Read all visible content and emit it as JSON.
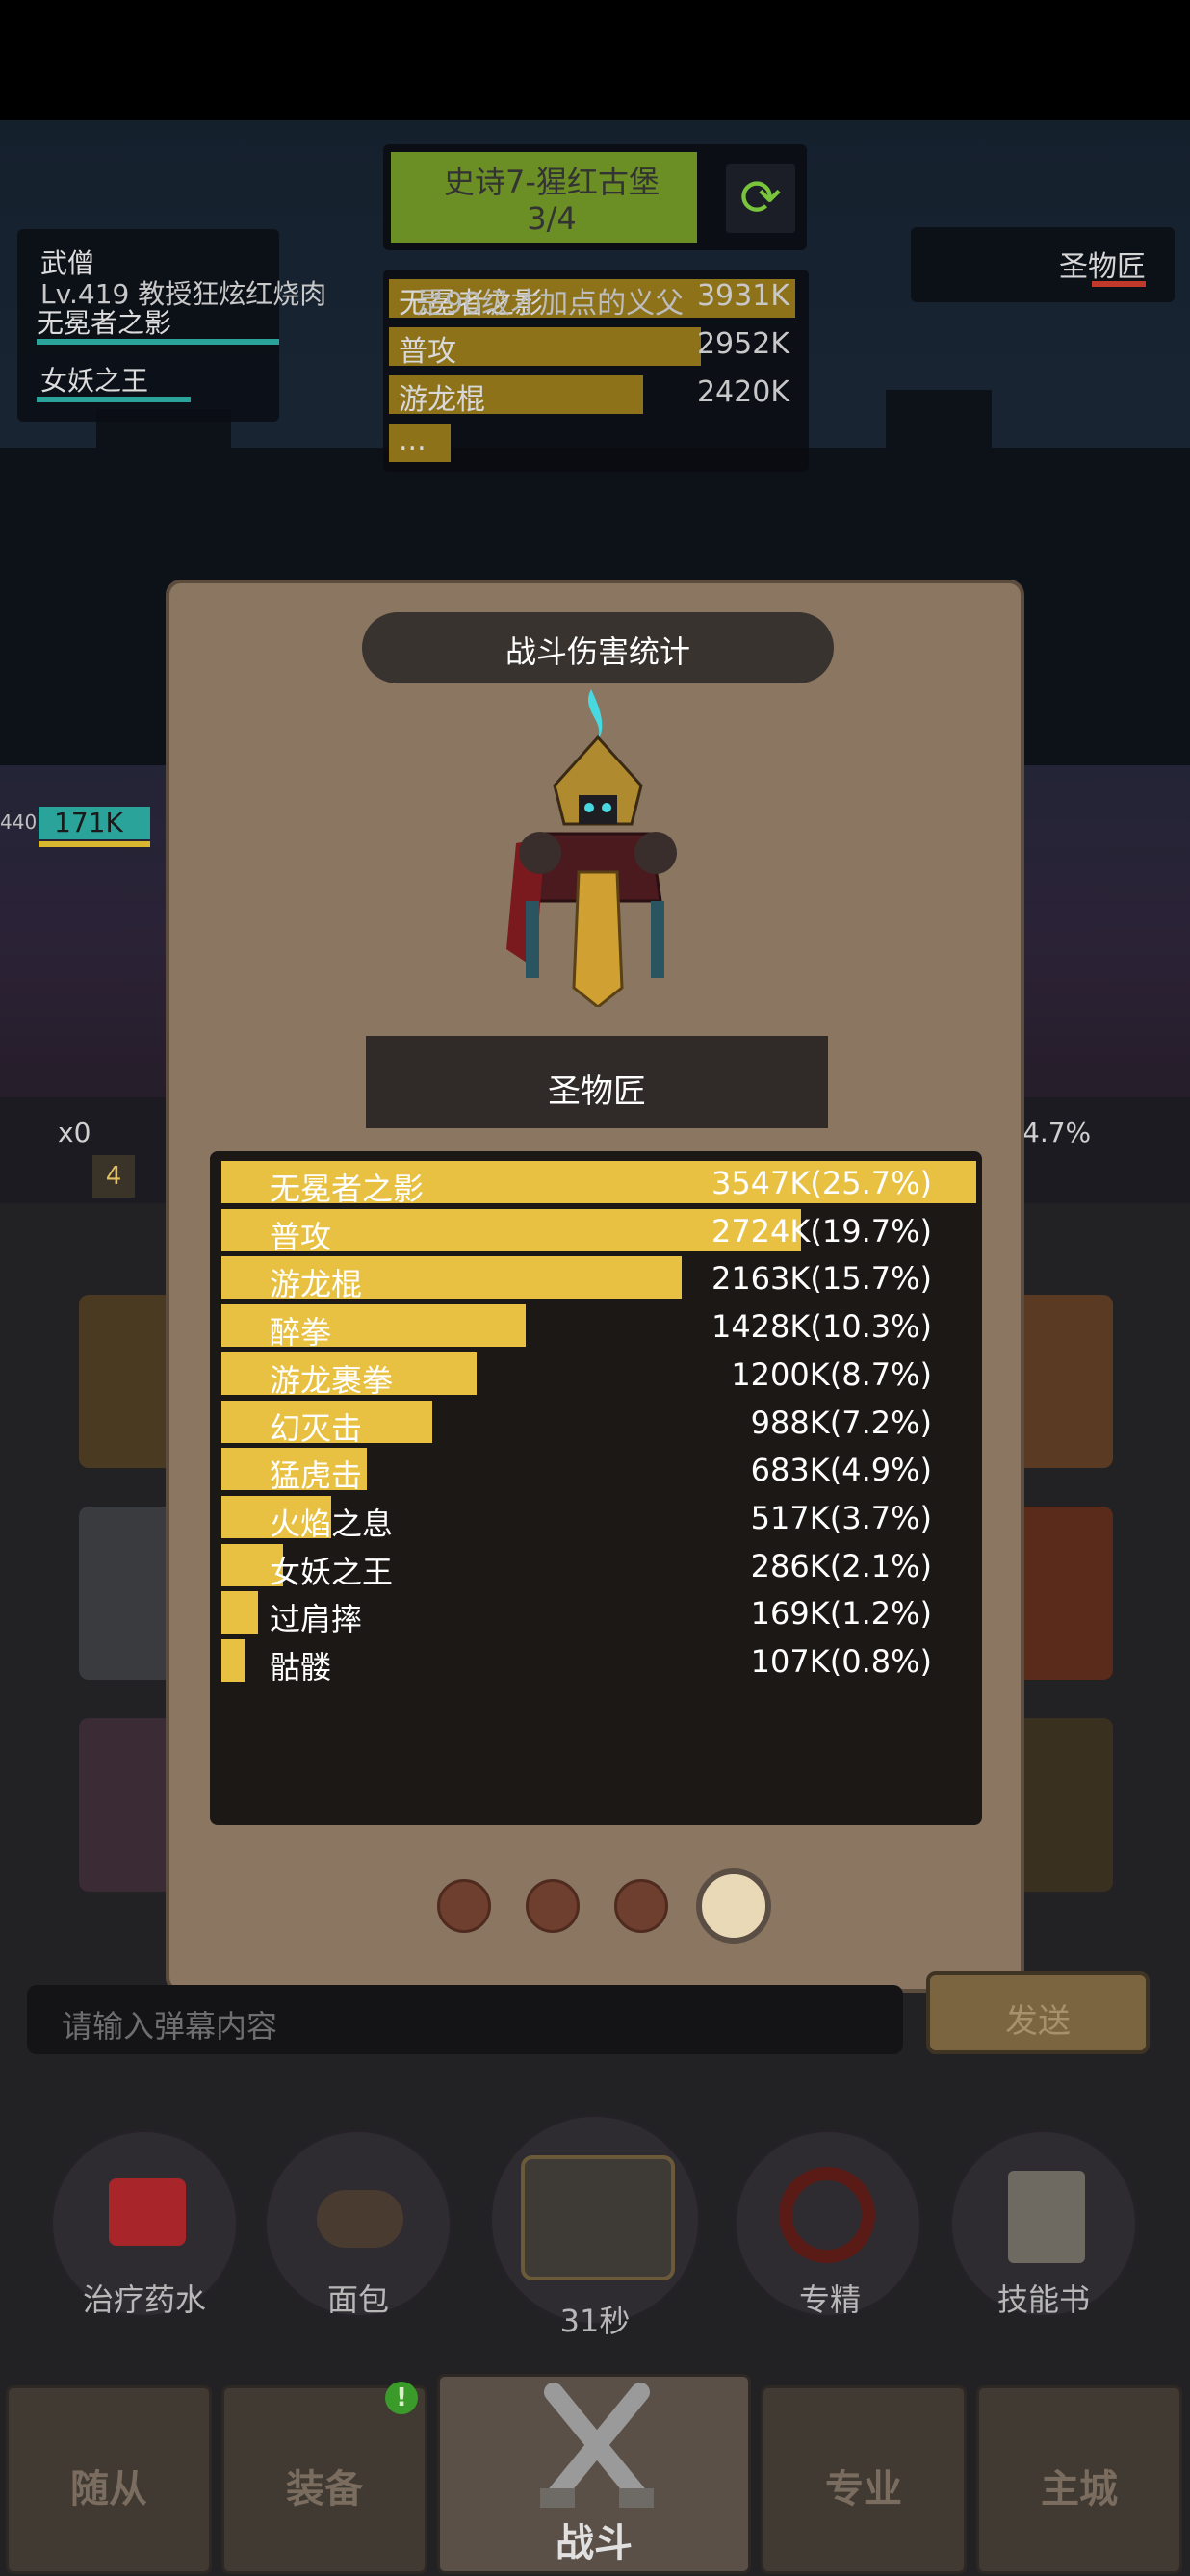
{
  "team_panel": {
    "class_name": "武僧",
    "chat_line": "Lv.419 教授狂炫红烧肉",
    "skill_1": "无冕者之影",
    "skill_2": "女妖之王"
  },
  "stage": {
    "title": "史诗7-猩红古堡",
    "progress": "3/4",
    "swap_icon": "refresh-icon"
  },
  "top_damage": {
    "rows": [
      {
        "name": "无冕者之影",
        "overlay_text": "是90级才加点的义父",
        "value": "3931K"
      },
      {
        "name": "普攻",
        "value": "2952K"
      },
      {
        "name": "游龙棍",
        "value": "2420K"
      },
      {
        "name": "...",
        "value": ""
      }
    ]
  },
  "boss": {
    "name": "圣物匠"
  },
  "side_readouts": {
    "hp_left_small": "440",
    "hp_left": "171K",
    "multiplier": "x0",
    "level_badge": "4",
    "right_percent": "4.7%"
  },
  "modal": {
    "title": "战斗伤害统计",
    "character_name": "圣物匠",
    "stats": [
      {
        "name": "无冕者之影",
        "value": "3547K(25.7%)",
        "share": 1.0
      },
      {
        "name": "普攻",
        "value": "2724K(19.7%)",
        "share": 0.768
      },
      {
        "name": "游龙棍",
        "value": "2163K(15.7%)",
        "share": 0.61
      },
      {
        "name": "醉拳",
        "value": "1428K(10.3%)",
        "share": 0.403
      },
      {
        "name": "游龙裹拳",
        "value": "1200K(8.7%)",
        "share": 0.338
      },
      {
        "name": "幻灭击",
        "value": "988K(7.2%)",
        "share": 0.279
      },
      {
        "name": "猛虎击",
        "value": "683K(4.9%)",
        "share": 0.193
      },
      {
        "name": "火焰之息",
        "value": "517K(3.7%)",
        "share": 0.146
      },
      {
        "name": "女妖之王",
        "value": "286K(2.1%)",
        "share": 0.081
      },
      {
        "name": "过肩摔",
        "value": "169K(1.2%)",
        "share": 0.048
      },
      {
        "name": "骷髅",
        "value": "107K(0.8%)",
        "share": 0.03
      }
    ],
    "pages": {
      "count": 4,
      "active_index": 3
    }
  },
  "chat": {
    "placeholder": "请输入弹幕内容",
    "send_label": "发送"
  },
  "quick_items": [
    {
      "label": "治疗药水",
      "icon": "potion-icon"
    },
    {
      "label": "面包",
      "icon": "bread-icon"
    },
    {
      "label": "31秒",
      "icon": "treasure-chest-icon"
    },
    {
      "label": "专精",
      "icon": "specialization-icon"
    },
    {
      "label": "技能书",
      "icon": "skill-book-icon"
    }
  ],
  "nav": {
    "items": [
      {
        "label": "随从"
      },
      {
        "label": "装备",
        "badge": "!"
      },
      {
        "label": "战斗",
        "icon": "crossed-swords-icon"
      },
      {
        "label": "专业"
      },
      {
        "label": "主城"
      }
    ],
    "active_index": 2
  },
  "colors": {
    "bar_yellow": "#e8c143",
    "modal_bg": "#8a7661",
    "stats_bg": "#1b1816",
    "teal_hp": "#2aa39a",
    "stage_green": "#6b8e25"
  }
}
